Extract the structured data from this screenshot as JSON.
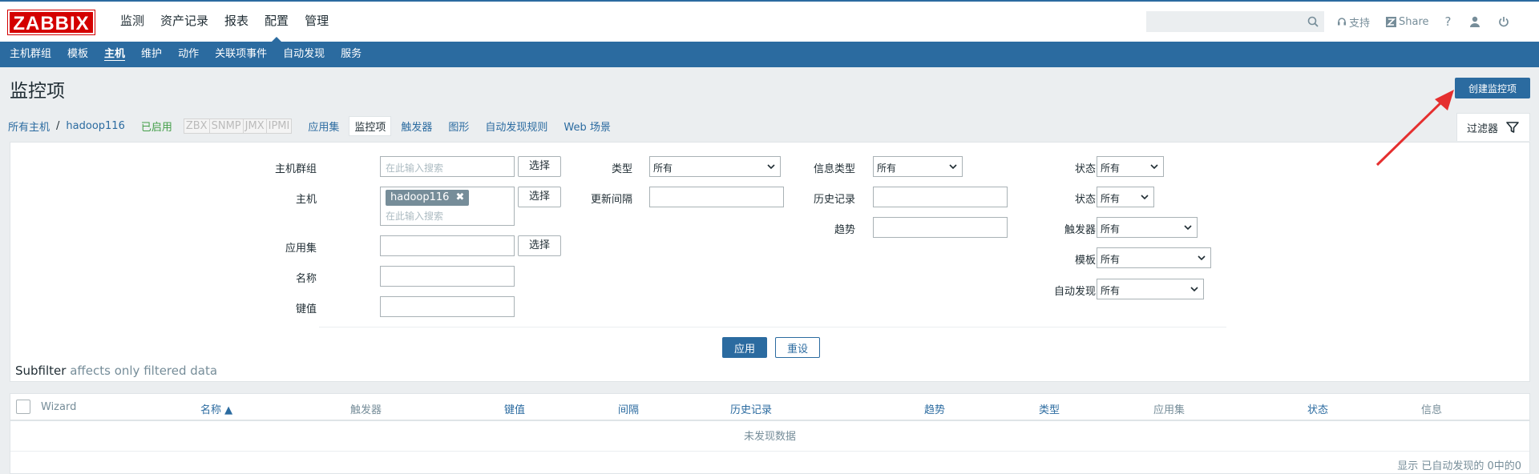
{
  "logo": "ZABBIX",
  "main_menu": [
    {
      "label": "监测"
    },
    {
      "label": "资产记录"
    },
    {
      "label": "报表"
    },
    {
      "label": "配置",
      "selected": true
    },
    {
      "label": "管理"
    }
  ],
  "top_links": {
    "support": "支持",
    "share": "Share",
    "help": "?"
  },
  "sub_menu": [
    {
      "label": "主机群组"
    },
    {
      "label": "模板"
    },
    {
      "label": "主机",
      "selected": true
    },
    {
      "label": "维护"
    },
    {
      "label": "动作"
    },
    {
      "label": "关联项事件"
    },
    {
      "label": "自动发现"
    },
    {
      "label": "服务"
    }
  ],
  "page": {
    "title": "监控项",
    "create_button": "创建监控项"
  },
  "breadcrumb": {
    "all_hosts": "所有主机",
    "separator": "/",
    "host": "hadoop116",
    "status": "已启用",
    "availability": [
      "ZBX",
      "SNMP",
      "JMX",
      "IPMI"
    ],
    "tabs": [
      {
        "label": "应用集"
      },
      {
        "label": "监控项",
        "selected": true
      },
      {
        "label": "触发器"
      },
      {
        "label": "图形"
      },
      {
        "label": "自动发现规则"
      },
      {
        "label": "Web 场景"
      }
    ]
  },
  "filter": {
    "tab_label": "过滤器",
    "host_group_label": "主机群组",
    "host_group_placeholder": "在此输入搜索",
    "host_label": "主机",
    "host_tag": "hadoop116",
    "host_placeholder": "在此输入搜索",
    "application_label": "应用集",
    "name_label": "名称",
    "key_label": "键值",
    "select_button": "选择",
    "type_label": "类型",
    "type_value": "所有",
    "interval_label": "更新间隔",
    "info_type_label": "信息类型",
    "info_type_value": "所有",
    "history_label": "历史记录",
    "trends_label": "趋势",
    "state_label": "状态",
    "state_value": "所有",
    "status_label": "状态",
    "status_value": "所有",
    "triggers_label": "触发器",
    "triggers_value": "所有",
    "template_label": "模板",
    "template_value": "所有",
    "discovery_label": "自动发现",
    "discovery_value": "所有",
    "apply_button": "应用",
    "reset_button": "重设"
  },
  "subfilter": {
    "title": "Subfilter",
    "hint": "affects only filtered data"
  },
  "table": {
    "columns": [
      "Wizard",
      "名称 ▲",
      "触发器",
      "键值",
      "间隔",
      "历史记录",
      "趋势",
      "类型",
      "应用集",
      "状态",
      "信息"
    ],
    "empty_text": "未发现数据",
    "footer": "显示 已自动发现的 0中的0"
  },
  "colors": {
    "brand_red": "#d40000",
    "accent_blue": "#2b6ba0",
    "enabled_green": "#429e47"
  }
}
